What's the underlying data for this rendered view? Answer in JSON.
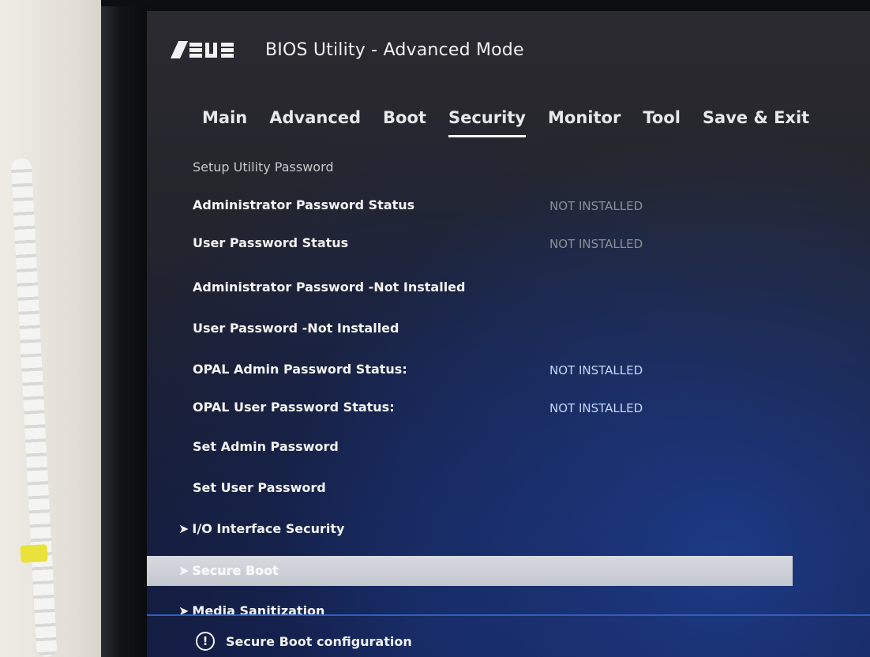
{
  "app": {
    "title": "BIOS Utility - Advanced Mode",
    "logo_text": "ASUS"
  },
  "tabs": [
    {
      "label": "Main"
    },
    {
      "label": "Advanced"
    },
    {
      "label": "Boot"
    },
    {
      "label": "Security",
      "active": true
    },
    {
      "label": "Monitor"
    },
    {
      "label": "Tool"
    },
    {
      "label": "Save & Exit"
    }
  ],
  "security": {
    "section_title": "Setup Utility Password",
    "rows": [
      {
        "label": "Administrator Password Status",
        "value": "NOT INSTALLED"
      },
      {
        "label": "User Password Status",
        "value": "NOT INSTALLED"
      },
      {
        "label": "Administrator Password -Not Installed"
      },
      {
        "label": "User Password -Not Installed"
      },
      {
        "label": "OPAL Admin Password Status:",
        "value": "NOT INSTALLED"
      },
      {
        "label": "OPAL User Password Status:",
        "value": "NOT INSTALLED"
      },
      {
        "label": "Set Admin Password"
      },
      {
        "label": "Set User Password"
      },
      {
        "label": "I/O Interface Security",
        "submenu": true
      },
      {
        "label": "Secure Boot",
        "submenu": true,
        "selected": true
      },
      {
        "label": "Media Sanitization",
        "submenu": true
      }
    ]
  },
  "help": {
    "icon": "info-icon",
    "text": "Secure Boot configuration"
  },
  "colors": {
    "accent": "#2e5fc0",
    "highlight": "#cfd2d8"
  }
}
